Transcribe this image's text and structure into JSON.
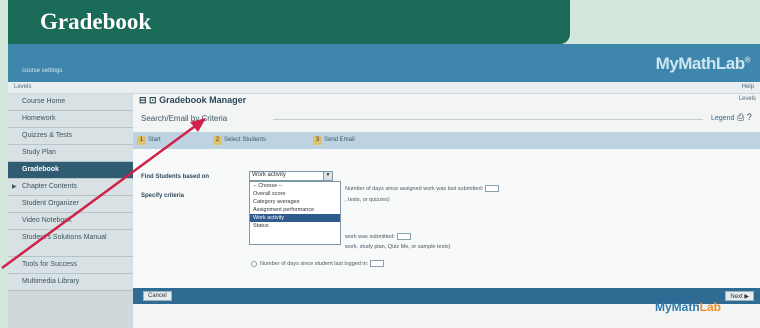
{
  "banner": {
    "title": "Gradebook"
  },
  "topbar": {
    "user": "course settings",
    "logo": "MyMathLab",
    "logo_mark": "®"
  },
  "subbar": {
    "left": "Levels",
    "right": "Help"
  },
  "sidebar": {
    "items": [
      {
        "label": "Course Home",
        "active": false
      },
      {
        "label": "Homework",
        "active": false
      },
      {
        "label": "Quizzes & Tests",
        "active": false
      },
      {
        "label": "Study Plan",
        "active": false
      },
      {
        "label": "Gradebook",
        "active": true
      },
      {
        "label": "Chapter Contents",
        "active": false
      },
      {
        "label": "Student Organizer",
        "active": false
      },
      {
        "label": "Video Notebook",
        "active": false
      },
      {
        "label": "Student's Solutions Manual",
        "active": false
      },
      {
        "label": "Tools for Success",
        "active": false
      },
      {
        "label": "Multimedia Library",
        "active": false
      }
    ]
  },
  "main": {
    "manager_title": "Gradebook Manager",
    "manager_right": "Levels",
    "section_title": "Search/Email by Criteria",
    "legend": "Legend",
    "steps": [
      {
        "num": "1",
        "label": "Start"
      },
      {
        "num": "2",
        "label": "Select Students"
      },
      {
        "num": "3",
        "label": "Send Email"
      }
    ],
    "find_label": "Find Students based on",
    "specify_label": "Specify criteria",
    "select_value": "Work activity",
    "dropdown_options": [
      {
        "label": "-- Choose --",
        "selected": false
      },
      {
        "label": "Overall score",
        "selected": false
      },
      {
        "label": "Category averages",
        "selected": false
      },
      {
        "label": "Assignment performance",
        "selected": false
      },
      {
        "label": "Work activity",
        "selected": true
      },
      {
        "label": "Status",
        "selected": false
      }
    ],
    "criteria": [
      {
        "text": "Number of days since assigned work was last submitted:"
      },
      {
        "text": ", tests, or quizzes)"
      },
      {
        "text": "work was submitted:"
      },
      {
        "text": "work, study plan, Quiz Me, or sample tests)"
      },
      {
        "text": "Number of days since student last logged in:"
      }
    ],
    "cancel_label": "Cancel",
    "next_label": "Next ▶",
    "footer_logo_a": "MyMath",
    "footer_logo_b": "Lab"
  },
  "colors": {
    "banner": "#1a6b57",
    "topbar": "#3e86ab",
    "active_nav": "#2f5b73",
    "arrow": "#d1214a"
  }
}
